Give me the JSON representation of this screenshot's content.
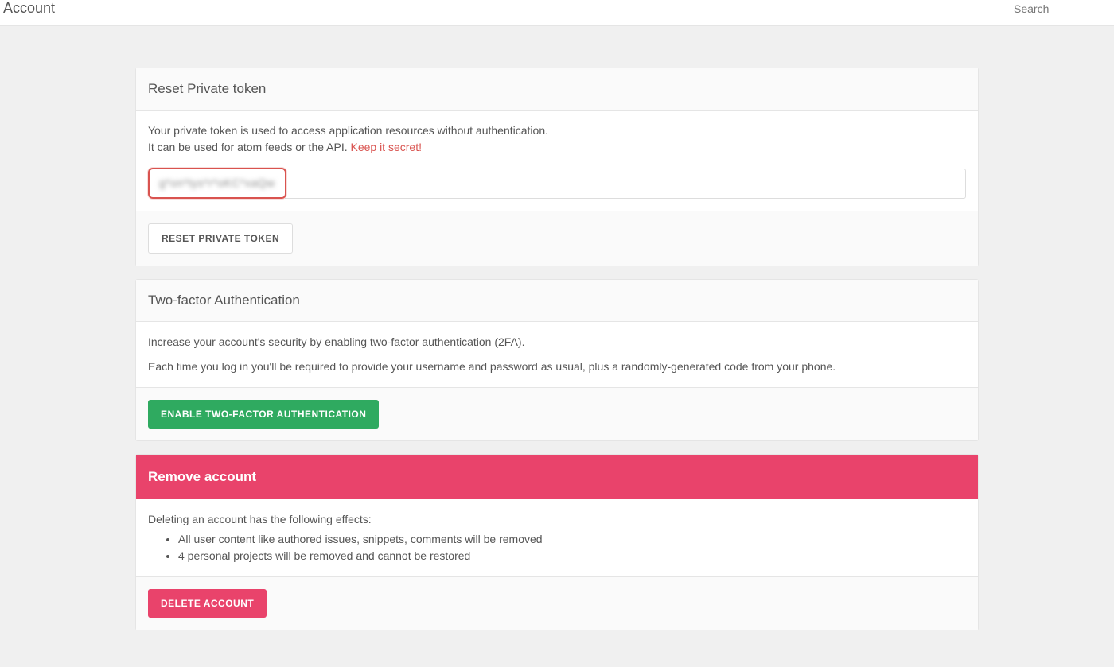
{
  "header": {
    "title": "Account",
    "search_placeholder": "Search"
  },
  "sections": {
    "private_token": {
      "title": "Reset Private token",
      "desc_line1": "Your private token is used to access application resources without authentication.",
      "desc_line2_a": "It can be used for atom feeds or the API. ",
      "desc_line2_b": "Keep it secret!",
      "token_value": "g*on*tys*r*oKC*xaQw",
      "button": "Reset private token"
    },
    "two_factor": {
      "title": "Two-factor Authentication",
      "desc1": "Increase your account's security by enabling two-factor authentication (2FA).",
      "desc2": "Each time you log in you'll be required to provide your username and password as usual, plus a randomly-generated code from your phone.",
      "button": "Enable Two-factor Authentication"
    },
    "remove": {
      "title": "Remove account",
      "intro": "Deleting an account has the following effects:",
      "effect1": "All user content like authored issues, snippets, comments will be removed",
      "effect2": "4 personal projects will be removed and cannot be restored",
      "button": "Delete account"
    }
  }
}
